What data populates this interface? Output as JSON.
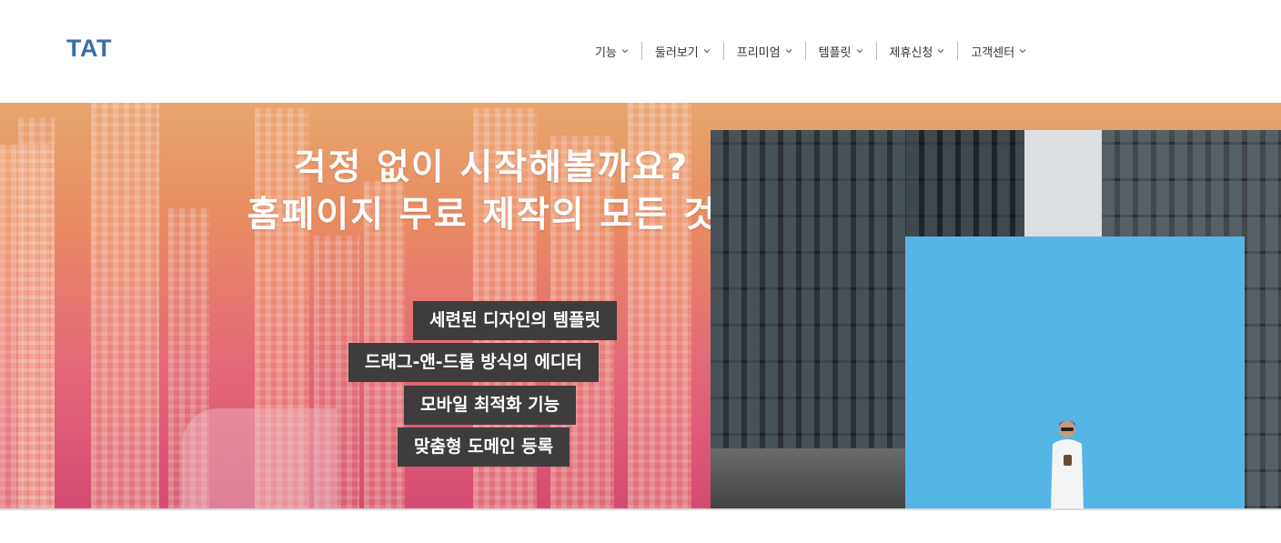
{
  "header": {
    "logo": "TAT",
    "nav": [
      {
        "label": "기능",
        "icon": "chevron-down-icon"
      },
      {
        "label": "둘러보기",
        "icon": "chevron-down-icon"
      },
      {
        "label": "프리미엄",
        "icon": "chevron-down-icon"
      },
      {
        "label": "템플릿",
        "icon": "chevron-down-icon"
      },
      {
        "label": "제휴신청",
        "icon": "chevron-down-icon"
      },
      {
        "label": "고객센터",
        "icon": "chevron-down-icon"
      }
    ]
  },
  "hero": {
    "title_line1": "걱정 없이 시작해볼까요?",
    "title_line2": "홈페이지 무료 제작의 모든 것!",
    "features": [
      "세련된 디자인의 템플릿",
      "드래그-앤-드롭 방식의 에디터",
      "모바일 최적화 기능",
      "맞춤형 도메인 등록"
    ],
    "colors": {
      "gradient_top": "#e7a56c",
      "gradient_bottom": "#d44b73",
      "feature_bg": "#3f3c3d",
      "logo": "#3b6ea8",
      "wall_blue": "#55b6e6"
    }
  }
}
